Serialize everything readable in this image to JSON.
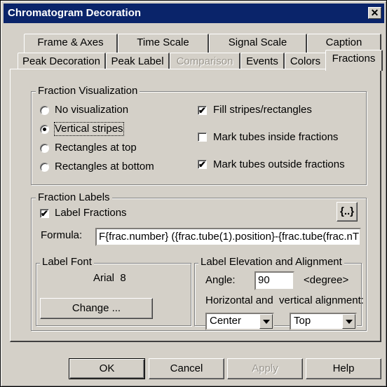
{
  "window": {
    "title": "Chromatogram Decoration",
    "close_glyph": "✕"
  },
  "tabs_row1": [
    "Frame & Axes",
    "Time Scale",
    "Signal Scale",
    "Caption"
  ],
  "tabs_row2": [
    "Peak Decoration",
    "Peak Label",
    "Comparison",
    "Events",
    "Colors",
    "Fractions"
  ],
  "active_tab": "Fractions",
  "fraction_visualization": {
    "legend": "Fraction Visualization",
    "radios": [
      {
        "label": "No visualization",
        "selected": false
      },
      {
        "label": "Vertical stripes",
        "selected": true
      },
      {
        "label": "Rectangles at top",
        "selected": false
      },
      {
        "label": "Rectangles at bottom",
        "selected": false
      }
    ],
    "checkboxes": [
      {
        "label": "Fill stripes/rectangles",
        "checked": true
      },
      {
        "label": "Mark tubes inside fractions",
        "checked": false
      },
      {
        "label": "Mark tubes outside fractions",
        "checked": true
      }
    ]
  },
  "fraction_labels": {
    "legend": "Fraction Labels",
    "label_fractions": "Label Fractions",
    "insert_button": "{..}",
    "formula_label": "Formula:",
    "formula_value": "F{frac.number} ({frac.tube(1).position}-{frac.tube(frac.nT"
  },
  "label_font": {
    "legend": "Label Font",
    "font": "Arial  8",
    "change_button": "Change ..."
  },
  "label_elevation": {
    "legend": "Label Elevation and Alignment",
    "angle_label": "Angle:",
    "angle_value": "90",
    "angle_unit": "<degree>",
    "alignment_label": "Horizontal and  vertical alignment:",
    "horizontal": "Center",
    "vertical": "Top"
  },
  "buttons": {
    "ok": "OK",
    "cancel": "Cancel",
    "apply": "Apply",
    "help": "Help"
  }
}
